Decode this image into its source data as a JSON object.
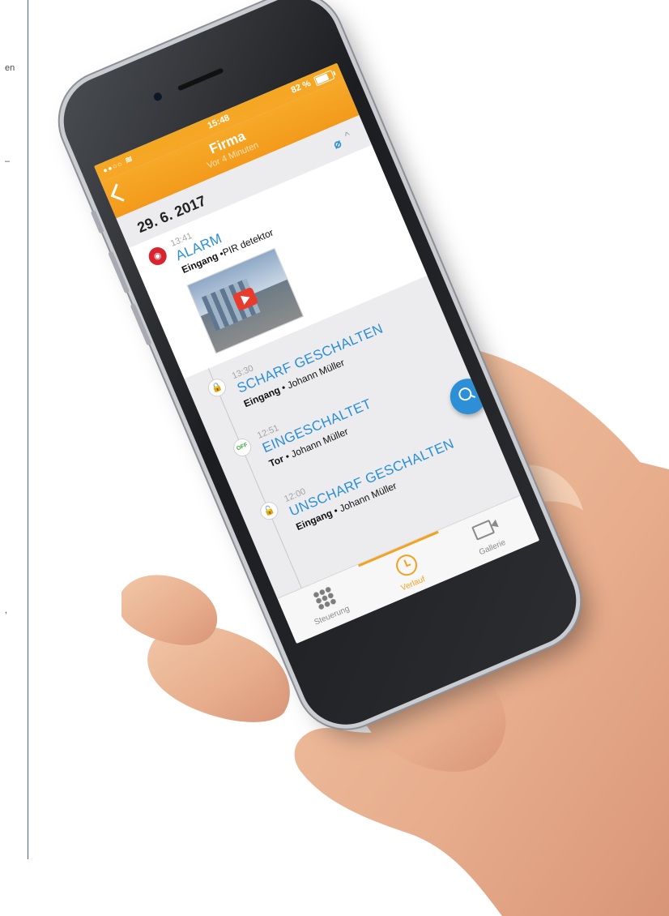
{
  "page_margin": {
    "fragments": [
      "en",
      "–",
      ","
    ]
  },
  "statusbar": {
    "signal": "●●○○",
    "time": "15:48",
    "battery_percent": "82 %"
  },
  "navbar": {
    "title": "Firma",
    "subtitle": "Vor 4 Minuten"
  },
  "date_header": {
    "date": "29. 6. 2017",
    "attachment_icon": "paperclip-icon",
    "collapse_icon": "chevron-up-icon"
  },
  "events": [
    {
      "time": "13:41",
      "title": "ALARM",
      "location": "Eingang",
      "separator": " •",
      "detail": "PIR detektor",
      "icon": "alarm-icon",
      "has_video": true
    },
    {
      "time": "13:30",
      "title": "SCHARF GESCHALTEN",
      "location": "Eingang",
      "separator": " • ",
      "detail": "Johann Müller",
      "icon": "lock-closed-icon",
      "icon_glyph": "🔒"
    },
    {
      "time": "12:51",
      "title": "EINGESCHALTET",
      "location": "Tor",
      "separator": " • ",
      "detail": "Johann Müller",
      "icon": "off-badge-icon",
      "icon_glyph": "OFF"
    },
    {
      "time": "12:00",
      "title": "UNSCHARF GESCHALTEN",
      "location": "Eingang",
      "separator": " • ",
      "detail": "Johann Müller",
      "icon": "lock-open-icon",
      "icon_glyph": "🔓"
    }
  ],
  "tabbar": {
    "tabs": [
      {
        "label": "Steuerung",
        "icon": "grid-icon",
        "active": false
      },
      {
        "label": "Verlauf",
        "icon": "clock-icon",
        "active": true
      },
      {
        "label": "Gallerie",
        "icon": "video-camera-icon",
        "active": false
      }
    ]
  },
  "colors": {
    "header_orange": "#f6a728",
    "accent_blue": "#2d8fd5",
    "alarm_red": "#d9232e",
    "status_green": "#3aa43a"
  }
}
